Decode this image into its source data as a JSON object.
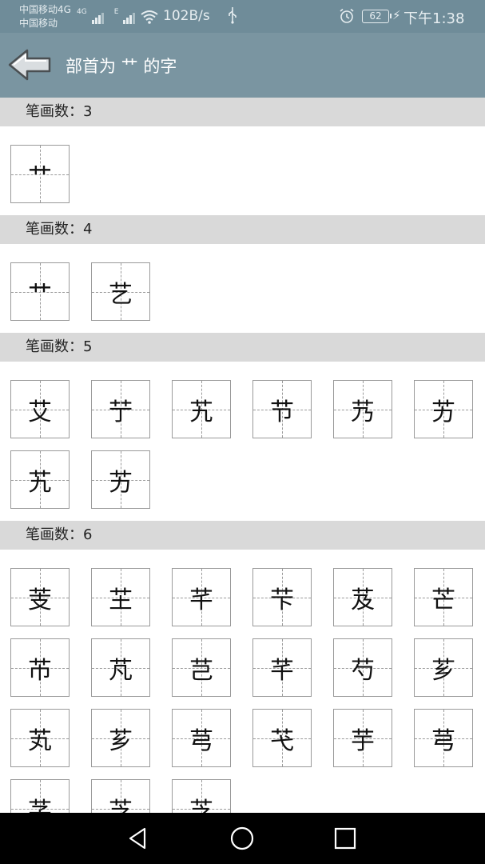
{
  "status_bar": {
    "carrier_line1": "中国移动4G",
    "carrier_line2": "中国移动",
    "network_small": "4G",
    "network_e": "E",
    "net_speed": "102B/s",
    "usb_icon": "usb-icon",
    "battery_level": "62",
    "time": "下午1:38"
  },
  "app_bar": {
    "back_icon": "back-arrow-icon",
    "title": "部首为 艹 的字"
  },
  "sections": [
    {
      "header": "笔画数：3",
      "chars": [
        "艹"
      ]
    },
    {
      "header": "笔画数：4",
      "chars": [
        "艹",
        "艺"
      ]
    },
    {
      "header": "笔画数：5",
      "chars": [
        "艾",
        "艼",
        "艽",
        "节",
        "艿",
        "艻",
        "艽",
        "艻"
      ]
    },
    {
      "header": "笔画数：6",
      "chars": [
        "芰",
        "芏",
        "芊",
        "芐",
        "芨",
        "芒",
        "芇",
        "芃",
        "芑",
        "芊",
        "芍",
        "芗",
        "芄",
        "芗",
        "芎",
        "芅",
        "芋",
        "芎",
        "芓",
        "芝",
        "芝"
      ]
    }
  ],
  "nav_bar": {
    "back": "nav-back-icon",
    "home": "nav-home-icon",
    "recents": "nav-recents-icon"
  }
}
